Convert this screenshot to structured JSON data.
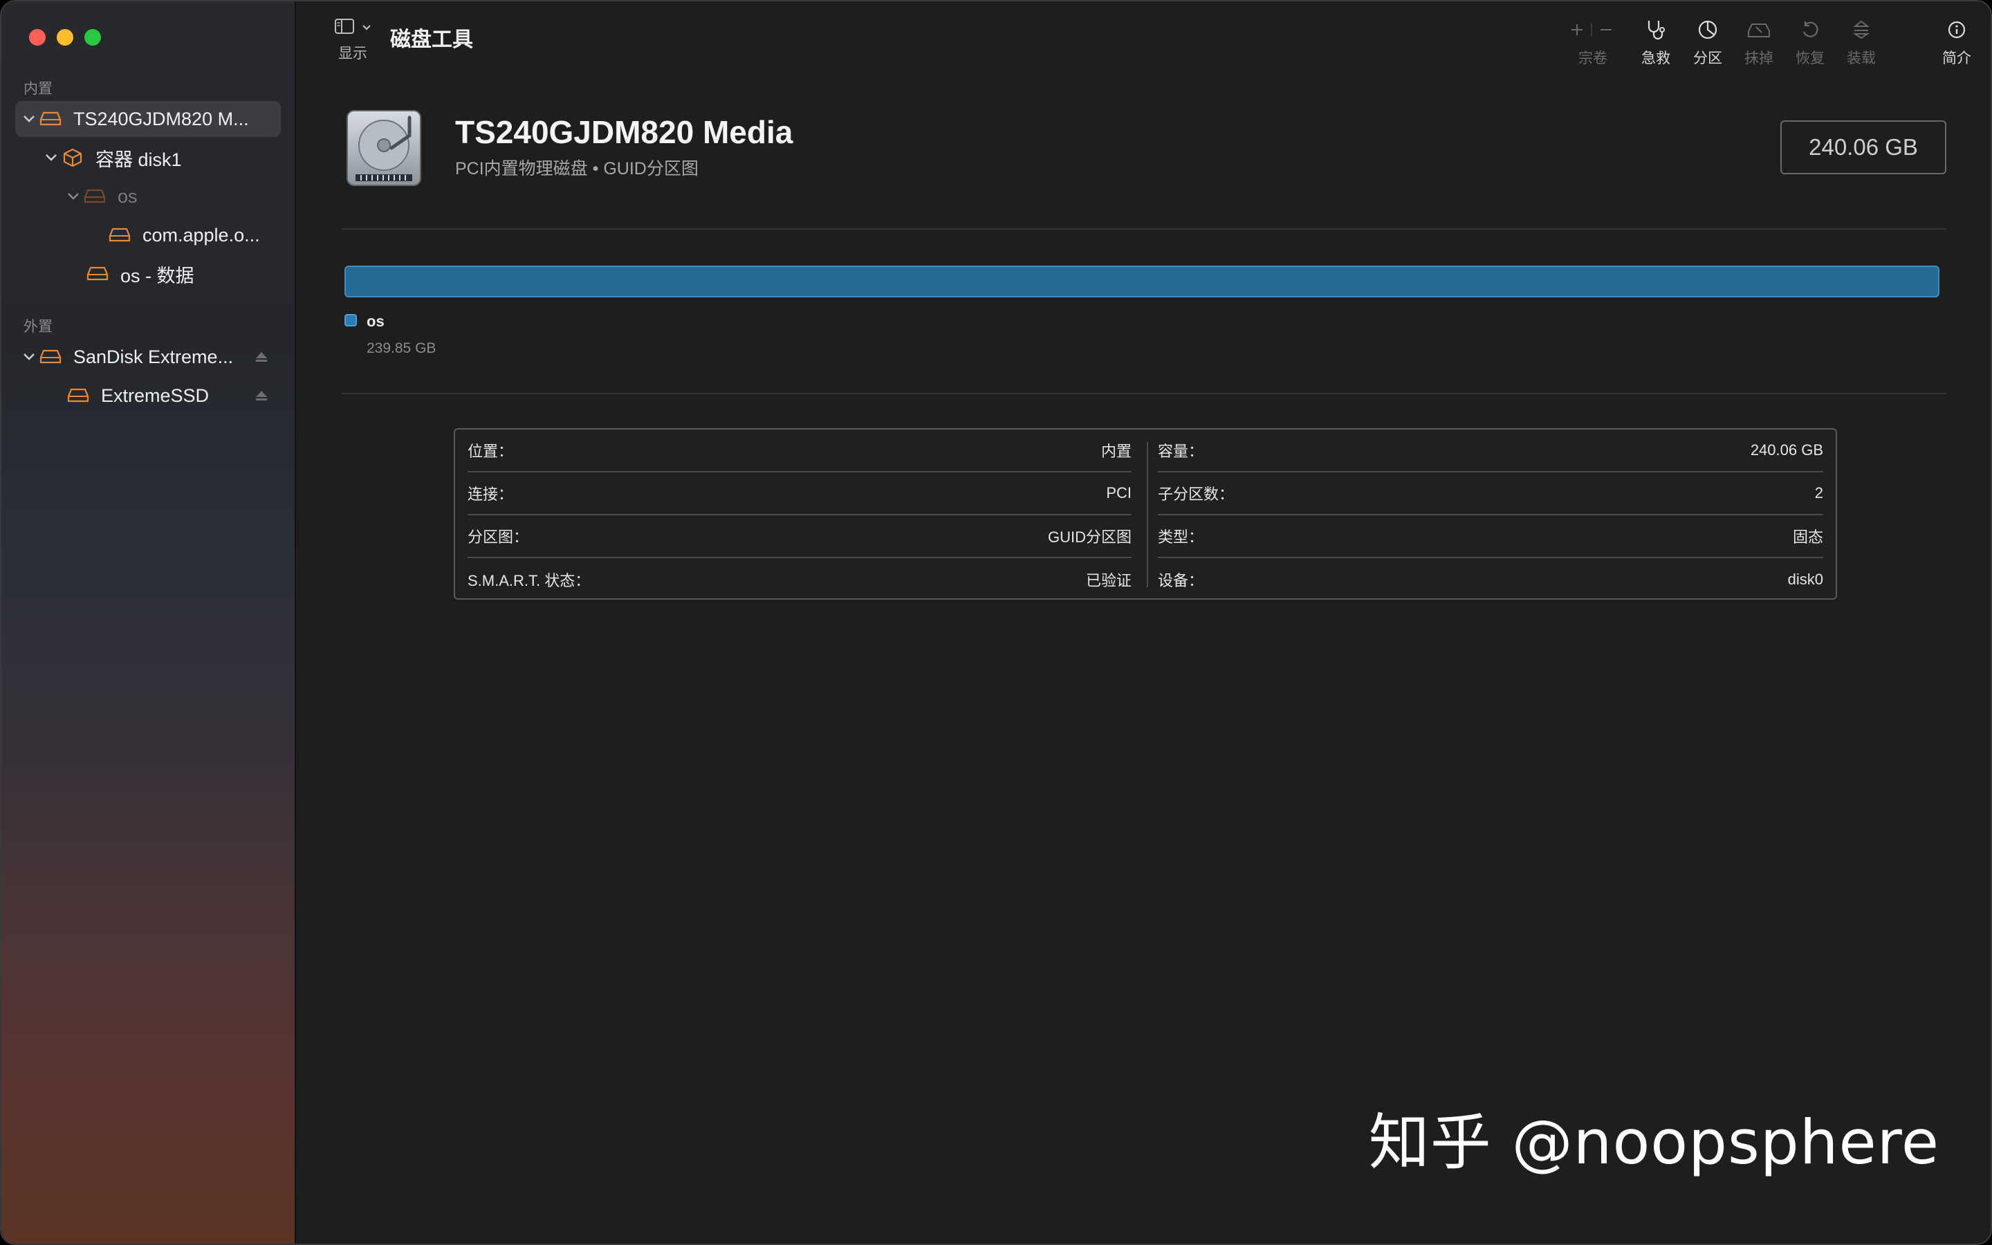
{
  "app": {
    "title": "磁盘工具"
  },
  "toolbar": {
    "view_label": "显示",
    "tools": [
      {
        "label": "宗卷",
        "icon": "plus-minus-icon",
        "enabled": false
      },
      {
        "label": "急救",
        "icon": "stethoscope-icon",
        "enabled": true
      },
      {
        "label": "分区",
        "icon": "pie-chart-icon",
        "enabled": true
      },
      {
        "label": "抹掉",
        "icon": "erase-icon",
        "enabled": false
      },
      {
        "label": "恢复",
        "icon": "restore-icon",
        "enabled": false
      },
      {
        "label": "装载",
        "icon": "mount-icon",
        "enabled": false
      },
      {
        "label": "简介",
        "icon": "info-icon",
        "enabled": true
      }
    ]
  },
  "sidebar": {
    "internal_label": "内置",
    "external_label": "外置",
    "items": [
      {
        "label": "TS240GJDM820 M..."
      },
      {
        "label": "容器 disk1"
      },
      {
        "label": "os"
      },
      {
        "label": "com.apple.o..."
      },
      {
        "label": "os - 数据"
      },
      {
        "label": "SanDisk Extreme..."
      },
      {
        "label": "ExtremeSSD"
      }
    ]
  },
  "disk": {
    "name": "TS240GJDM820 Media",
    "subtitle": "PCI内置物理磁盘 • GUID分区图",
    "capacity": "240.06 GB"
  },
  "usage": {
    "segment_name": "os",
    "segment_size": "239.85 GB",
    "color": "#256a93",
    "fraction": 1.0
  },
  "info": {
    "left": [
      {
        "key": "位置：",
        "value": "内置"
      },
      {
        "key": "连接：",
        "value": "PCI"
      },
      {
        "key": "分区图：",
        "value": "GUID分区图"
      },
      {
        "key": "S.M.A.R.T. 状态：",
        "value": "已验证"
      }
    ],
    "right": [
      {
        "key": "容量：",
        "value": "240.06 GB"
      },
      {
        "key": "子分区数：",
        "value": "2"
      },
      {
        "key": "类型：",
        "value": "固态"
      },
      {
        "key": "设备：",
        "value": "disk0"
      }
    ]
  },
  "watermark": "知乎 @noopsphere",
  "colors": {
    "accent_orange": "#e8893a",
    "bar_blue": "#256a93"
  }
}
